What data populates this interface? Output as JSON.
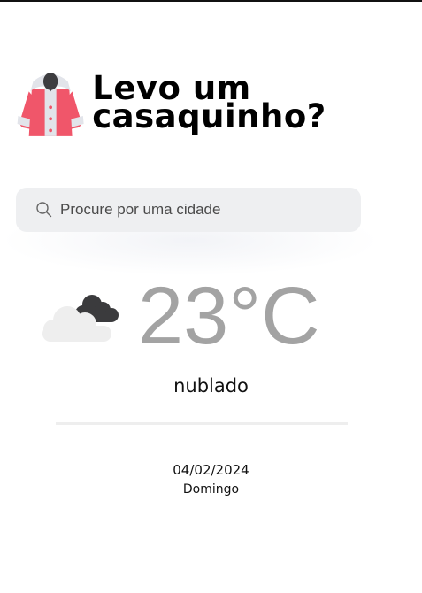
{
  "header": {
    "title": "Levo um casaquinho?",
    "logo_icon": "coat-icon"
  },
  "search": {
    "placeholder": "Procure por uma cidade",
    "icon": "search-icon"
  },
  "weather": {
    "icon": "cloudy-icon",
    "temperature": "23°C",
    "condition": "nublado",
    "date": "04/02/2024",
    "weekday": "Domingo"
  },
  "colors": {
    "coat": "#f0566a",
    "search_bg": "#eeeff1",
    "temperature": "#a3a3a3",
    "dark_cloud": "#3b3b3d",
    "light_cloud": "#eeeeee"
  }
}
